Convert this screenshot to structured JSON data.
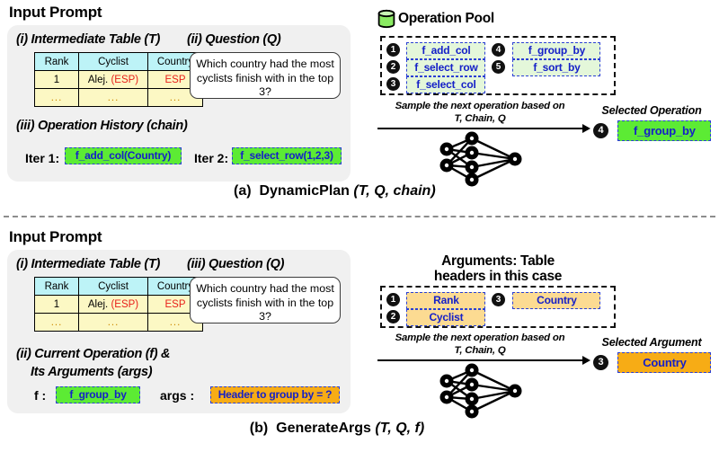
{
  "figure": {
    "divider": "dashed-horizontal-rule"
  },
  "panel_a": {
    "input_prompt_title": "Input Prompt",
    "parts": {
      "table_label": "(i) Intermediate Table (T)",
      "question_label": "(ii) Question (Q)",
      "history_label": "(iii) Operation History (chain)"
    },
    "table": {
      "headers": [
        "Rank",
        "Cyclist",
        "Country"
      ],
      "rows": [
        [
          "1",
          "Alej. (ESP)",
          "ESP"
        ],
        [
          "...",
          "...",
          "..."
        ]
      ],
      "header_color": "#bdf3f7",
      "body_color": "#fcf8c4",
      "highlight_color": "#e8201a"
    },
    "question": "Which country had the most cyclists finish with in the top 3?",
    "history": [
      {
        "iter_label": "Iter 1:",
        "op": "f_add_col(Country)"
      },
      {
        "iter_label": "Iter 2:",
        "op": "f_select_row(1,2,3)"
      }
    ],
    "pool": {
      "title": "Operation Pool",
      "icon": "database-icon",
      "items": [
        {
          "num": "1",
          "label": "f_add_col"
        },
        {
          "num": "2",
          "label": "f_select_row"
        },
        {
          "num": "3",
          "label": "f_select_col"
        },
        {
          "num": "4",
          "label": "f_group_by"
        },
        {
          "num": "5",
          "label": "f_sort_by"
        }
      ]
    },
    "arrow_caption_line1": "Sample the next operation based on",
    "arrow_caption_line2": "T, Chain, Q",
    "selected_label": "Selected Operation",
    "selected": {
      "num": "4",
      "label": "f_group_by"
    },
    "caption_prefix": "(a)",
    "caption_name": "DynamicPlan",
    "caption_args": "(T, Q, chain)"
  },
  "panel_b": {
    "input_prompt_title": "Input Prompt",
    "parts": {
      "table_label": "(i) Intermediate Table (T)",
      "question_label": "(iii) Question (Q)",
      "operation_label_line1": "(ii) Current Operation (f) &",
      "operation_label_line2": "Its Arguments (args)"
    },
    "table": {
      "headers": [
        "Rank",
        "Cyclist",
        "Country"
      ],
      "rows": [
        [
          "1",
          "Alej. (ESP)",
          "ESP"
        ],
        [
          "...",
          "...",
          "..."
        ]
      ]
    },
    "question": "Which country had the most cyclists finish with in the top 3?",
    "f_label": "f :",
    "f_value": "f_group_by",
    "args_label": "args :",
    "args_value": "Header to group by = ?",
    "pool": {
      "title_line1": "Arguments: Table",
      "title_line2": "headers in this case",
      "items": [
        {
          "num": "1",
          "label": "Rank"
        },
        {
          "num": "2",
          "label": "Cyclist"
        },
        {
          "num": "3",
          "label": "Country"
        }
      ]
    },
    "arrow_caption_line1": "Sample the next operation based on",
    "arrow_caption_line2": "T, Chain, Q",
    "selected_label": "Selected Argument",
    "selected": {
      "num": "3",
      "label": "Country"
    },
    "caption_prefix": "(b)",
    "caption_name": "GenerateArgs",
    "caption_args": "(T, Q, f)"
  },
  "colors": {
    "chip_green_bright": "#5ceb34",
    "chip_green_pale": "#e4f7da",
    "chip_orange_bright": "#f7ac15",
    "chip_orange_pale": "#fcdb92",
    "chip_border_blue": "#2b3fd4",
    "chip_text_blue": "#1520c8"
  }
}
